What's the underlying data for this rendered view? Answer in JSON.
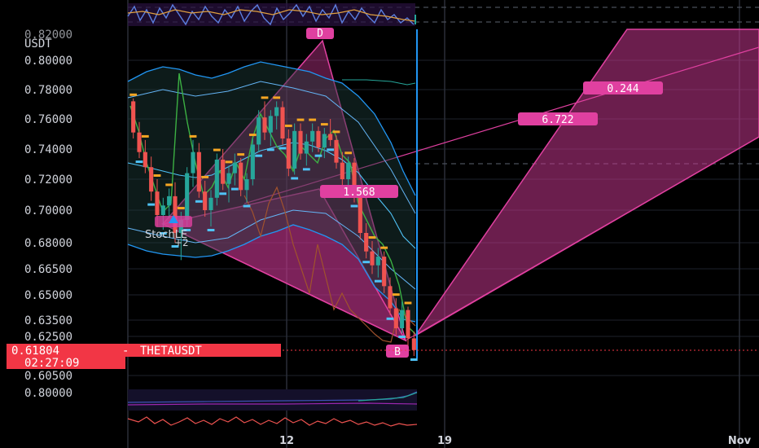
{
  "chart_data": {
    "type": "candlestick",
    "symbol": "THETAUSDT",
    "currency": "USDT",
    "last_price": "0.61804",
    "countdown": "02:27:09",
    "price_axis_partial_label": "0.82000",
    "price_ticks": [
      "0.80000",
      "0.78000",
      "0.76000",
      "0.74000",
      "0.72000",
      "0.70000",
      "0.68000",
      "0.66500",
      "0.65000",
      "0.63500",
      "0.62500",
      "0.60500"
    ],
    "price_tick_values": [
      0.8,
      0.78,
      0.76,
      0.74,
      0.72,
      0.7,
      0.68,
      0.665,
      0.65,
      0.635,
      0.625,
      0.605
    ],
    "indicator_pane_tick": "0.80000",
    "x_ticks": [
      "12",
      "19",
      "Nov"
    ],
    "strategy_label": "StochLE",
    "strategy_sub": "+2",
    "pattern_points": [
      "D",
      "B"
    ],
    "ratio_labels": [
      "1.568",
      "6.722",
      "0.244"
    ],
    "colors": {
      "up": "#26a69a",
      "down": "#ef5350",
      "pattern": "#e040a0",
      "bands": "#2196f3",
      "price_line": "#f23645"
    },
    "candles": [
      [
        0.772,
        0.774,
        0.747,
        0.751
      ],
      [
        0.751,
        0.758,
        0.734,
        0.738
      ],
      [
        0.738,
        0.746,
        0.724,
        0.728
      ],
      [
        0.728,
        0.735,
        0.706,
        0.712
      ],
      [
        0.712,
        0.72,
        0.69,
        0.697
      ],
      [
        0.697,
        0.708,
        0.688,
        0.703
      ],
      [
        0.703,
        0.714,
        0.695,
        0.709
      ],
      [
        0.709,
        0.718,
        0.68,
        0.686
      ],
      [
        0.686,
        0.699,
        0.67,
        0.694
      ],
      [
        0.694,
        0.728,
        0.69,
        0.724
      ],
      [
        0.724,
        0.746,
        0.715,
        0.738
      ],
      [
        0.738,
        0.744,
        0.708,
        0.712
      ],
      [
        0.712,
        0.719,
        0.696,
        0.7
      ],
      [
        0.7,
        0.713,
        0.69,
        0.708
      ],
      [
        0.708,
        0.737,
        0.703,
        0.733
      ],
      [
        0.733,
        0.74,
        0.713,
        0.717
      ],
      [
        0.717,
        0.729,
        0.705,
        0.724
      ],
      [
        0.724,
        0.737,
        0.716,
        0.731
      ],
      [
        0.731,
        0.734,
        0.709,
        0.713
      ],
      [
        0.713,
        0.724,
        0.705,
        0.72
      ],
      [
        0.72,
        0.747,
        0.716,
        0.743
      ],
      [
        0.743,
        0.766,
        0.738,
        0.761
      ],
      [
        0.761,
        0.772,
        0.746,
        0.751
      ],
      [
        0.751,
        0.766,
        0.742,
        0.762
      ],
      [
        0.762,
        0.772,
        0.753,
        0.768
      ],
      [
        0.768,
        0.772,
        0.743,
        0.747
      ],
      [
        0.747,
        0.753,
        0.722,
        0.727
      ],
      [
        0.727,
        0.757,
        0.723,
        0.752
      ],
      [
        0.752,
        0.757,
        0.733,
        0.737
      ],
      [
        0.737,
        0.75,
        0.729,
        0.745
      ],
      [
        0.745,
        0.757,
        0.738,
        0.752
      ],
      [
        0.752,
        0.755,
        0.738,
        0.741
      ],
      [
        0.741,
        0.754,
        0.734,
        0.75
      ],
      [
        0.75,
        0.76,
        0.742,
        0.746
      ],
      [
        0.746,
        0.749,
        0.727,
        0.731
      ],
      [
        0.731,
        0.738,
        0.716,
        0.72
      ],
      [
        0.72,
        0.735,
        0.714,
        0.731
      ],
      [
        0.731,
        0.734,
        0.705,
        0.708
      ],
      [
        0.708,
        0.713,
        0.682,
        0.686
      ],
      [
        0.686,
        0.692,
        0.671,
        0.675
      ],
      [
        0.675,
        0.681,
        0.662,
        0.667
      ],
      [
        0.667,
        0.677,
        0.66,
        0.672
      ],
      [
        0.672,
        0.675,
        0.651,
        0.655
      ],
      [
        0.655,
        0.66,
        0.638,
        0.642
      ],
      [
        0.642,
        0.648,
        0.626,
        0.63
      ],
      [
        0.63,
        0.646,
        0.627,
        0.641
      ],
      [
        0.641,
        0.643,
        0.619,
        0.624
      ],
      [
        0.624,
        0.628,
        0.615,
        0.618
      ]
    ]
  }
}
